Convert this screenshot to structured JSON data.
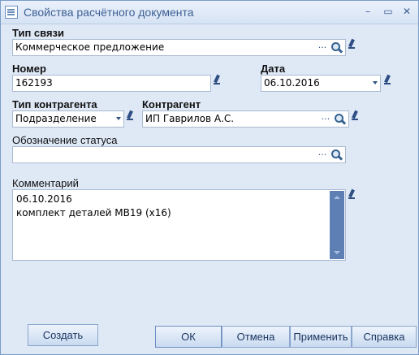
{
  "window": {
    "title": "Свойства расчётного документа"
  },
  "icons": [
    "minimize-icon",
    "maximize-icon",
    "close-icon",
    "search-icon",
    "edit-pencil-icon",
    "dropdown-arrow-icon"
  ],
  "fields": {
    "link_type": {
      "label": "Тип связи",
      "value": "Коммерческое предложение"
    },
    "number": {
      "label": "Номер",
      "value": "162193"
    },
    "date": {
      "label": "Дата",
      "value": "06.10.2016"
    },
    "counterparty_type": {
      "label": "Тип контрагента",
      "value": "Подразделение"
    },
    "counterparty": {
      "label": "Контрагент",
      "value": "ИП Гаврилов А.С."
    },
    "status": {
      "label": "Обозначение статуса",
      "value": ""
    },
    "comment": {
      "label": "Комментарий",
      "lines": [
        "06.10.2016",
        "комплект деталей МВ19 (х16)"
      ]
    }
  },
  "buttons": {
    "create": "Создать",
    "ok": "ОК",
    "cancel": "Отмена",
    "apply": "Применить",
    "help": "Справка"
  },
  "dots_label": "···"
}
